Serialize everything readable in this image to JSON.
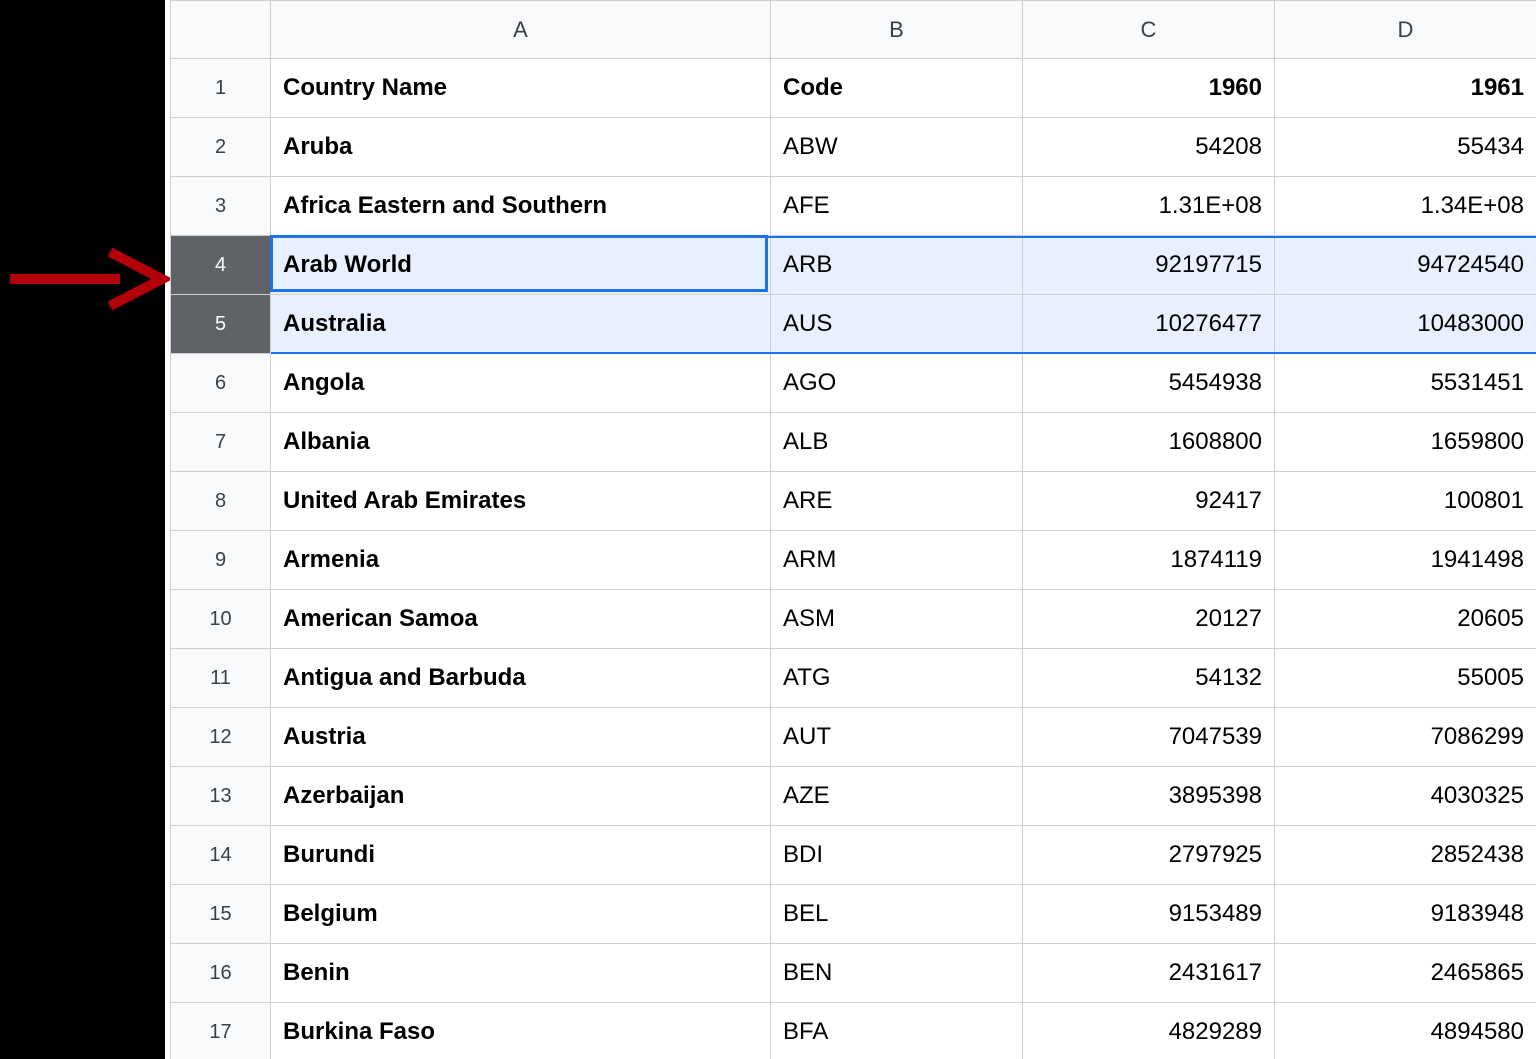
{
  "annotation": {
    "kind": "arrow",
    "target_row": 4
  },
  "columns": [
    "A",
    "B",
    "C",
    "D"
  ],
  "headers": {
    "country": "Country Name",
    "code": "Code",
    "y1960": "1960",
    "y1961": "1961"
  },
  "selected_rows": [
    4,
    5
  ],
  "active_cell": "A4",
  "rows": [
    {
      "n": 1,
      "country": "Country Name",
      "code": "Code",
      "y1960": "1960",
      "y1961": "1961",
      "is_header": true
    },
    {
      "n": 2,
      "country": "Aruba",
      "code": "ABW",
      "y1960": "54208",
      "y1961": "55434"
    },
    {
      "n": 3,
      "country": "Africa Eastern and Southern",
      "code": "AFE",
      "y1960": "1.31E+08",
      "y1961": "1.34E+08"
    },
    {
      "n": 4,
      "country": "Arab World",
      "code": "ARB",
      "y1960": "92197715",
      "y1961": "94724540"
    },
    {
      "n": 5,
      "country": "Australia",
      "code": "AUS",
      "y1960": "10276477",
      "y1961": "10483000"
    },
    {
      "n": 6,
      "country": "Angola",
      "code": "AGO",
      "y1960": "5454938",
      "y1961": "5531451"
    },
    {
      "n": 7,
      "country": "Albania",
      "code": "ALB",
      "y1960": "1608800",
      "y1961": "1659800"
    },
    {
      "n": 8,
      "country": "United Arab Emirates",
      "code": "ARE",
      "y1960": "92417",
      "y1961": "100801"
    },
    {
      "n": 9,
      "country": "Armenia",
      "code": "ARM",
      "y1960": "1874119",
      "y1961": "1941498"
    },
    {
      "n": 10,
      "country": "American Samoa",
      "code": "ASM",
      "y1960": "20127",
      "y1961": "20605"
    },
    {
      "n": 11,
      "country": "Antigua and Barbuda",
      "code": "ATG",
      "y1960": "54132",
      "y1961": "55005"
    },
    {
      "n": 12,
      "country": "Austria",
      "code": "AUT",
      "y1960": "7047539",
      "y1961": "7086299"
    },
    {
      "n": 13,
      "country": "Azerbaijan",
      "code": "AZE",
      "y1960": "3895398",
      "y1961": "4030325"
    },
    {
      "n": 14,
      "country": "Burundi",
      "code": "BDI",
      "y1960": "2797925",
      "y1961": "2852438"
    },
    {
      "n": 15,
      "country": "Belgium",
      "code": "BEL",
      "y1960": "9153489",
      "y1961": "9183948"
    },
    {
      "n": 16,
      "country": "Benin",
      "code": "BEN",
      "y1960": "2431617",
      "y1961": "2465865"
    },
    {
      "n": 17,
      "country": "Burkina Faso",
      "code": "BFA",
      "y1960": "4829289",
      "y1961": "4894580"
    }
  ]
}
